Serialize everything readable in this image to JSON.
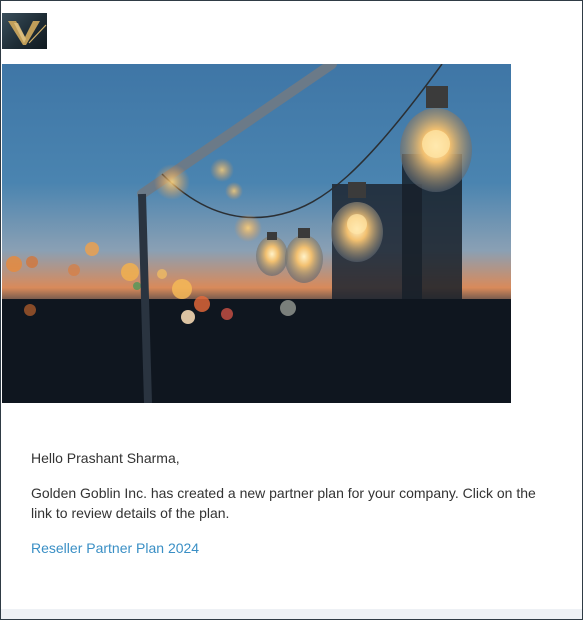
{
  "email": {
    "logo_icon": "golden-goblin-logo",
    "hero_image": "string-lights-at-dusk",
    "greeting": "Hello Prashant Sharma,",
    "message": "Golden Goblin Inc. has created a new partner plan for your company. Click on the link to review details of the plan.",
    "plan_link": "Reseller Partner Plan 2024",
    "link_color": "#3a8fc5"
  }
}
